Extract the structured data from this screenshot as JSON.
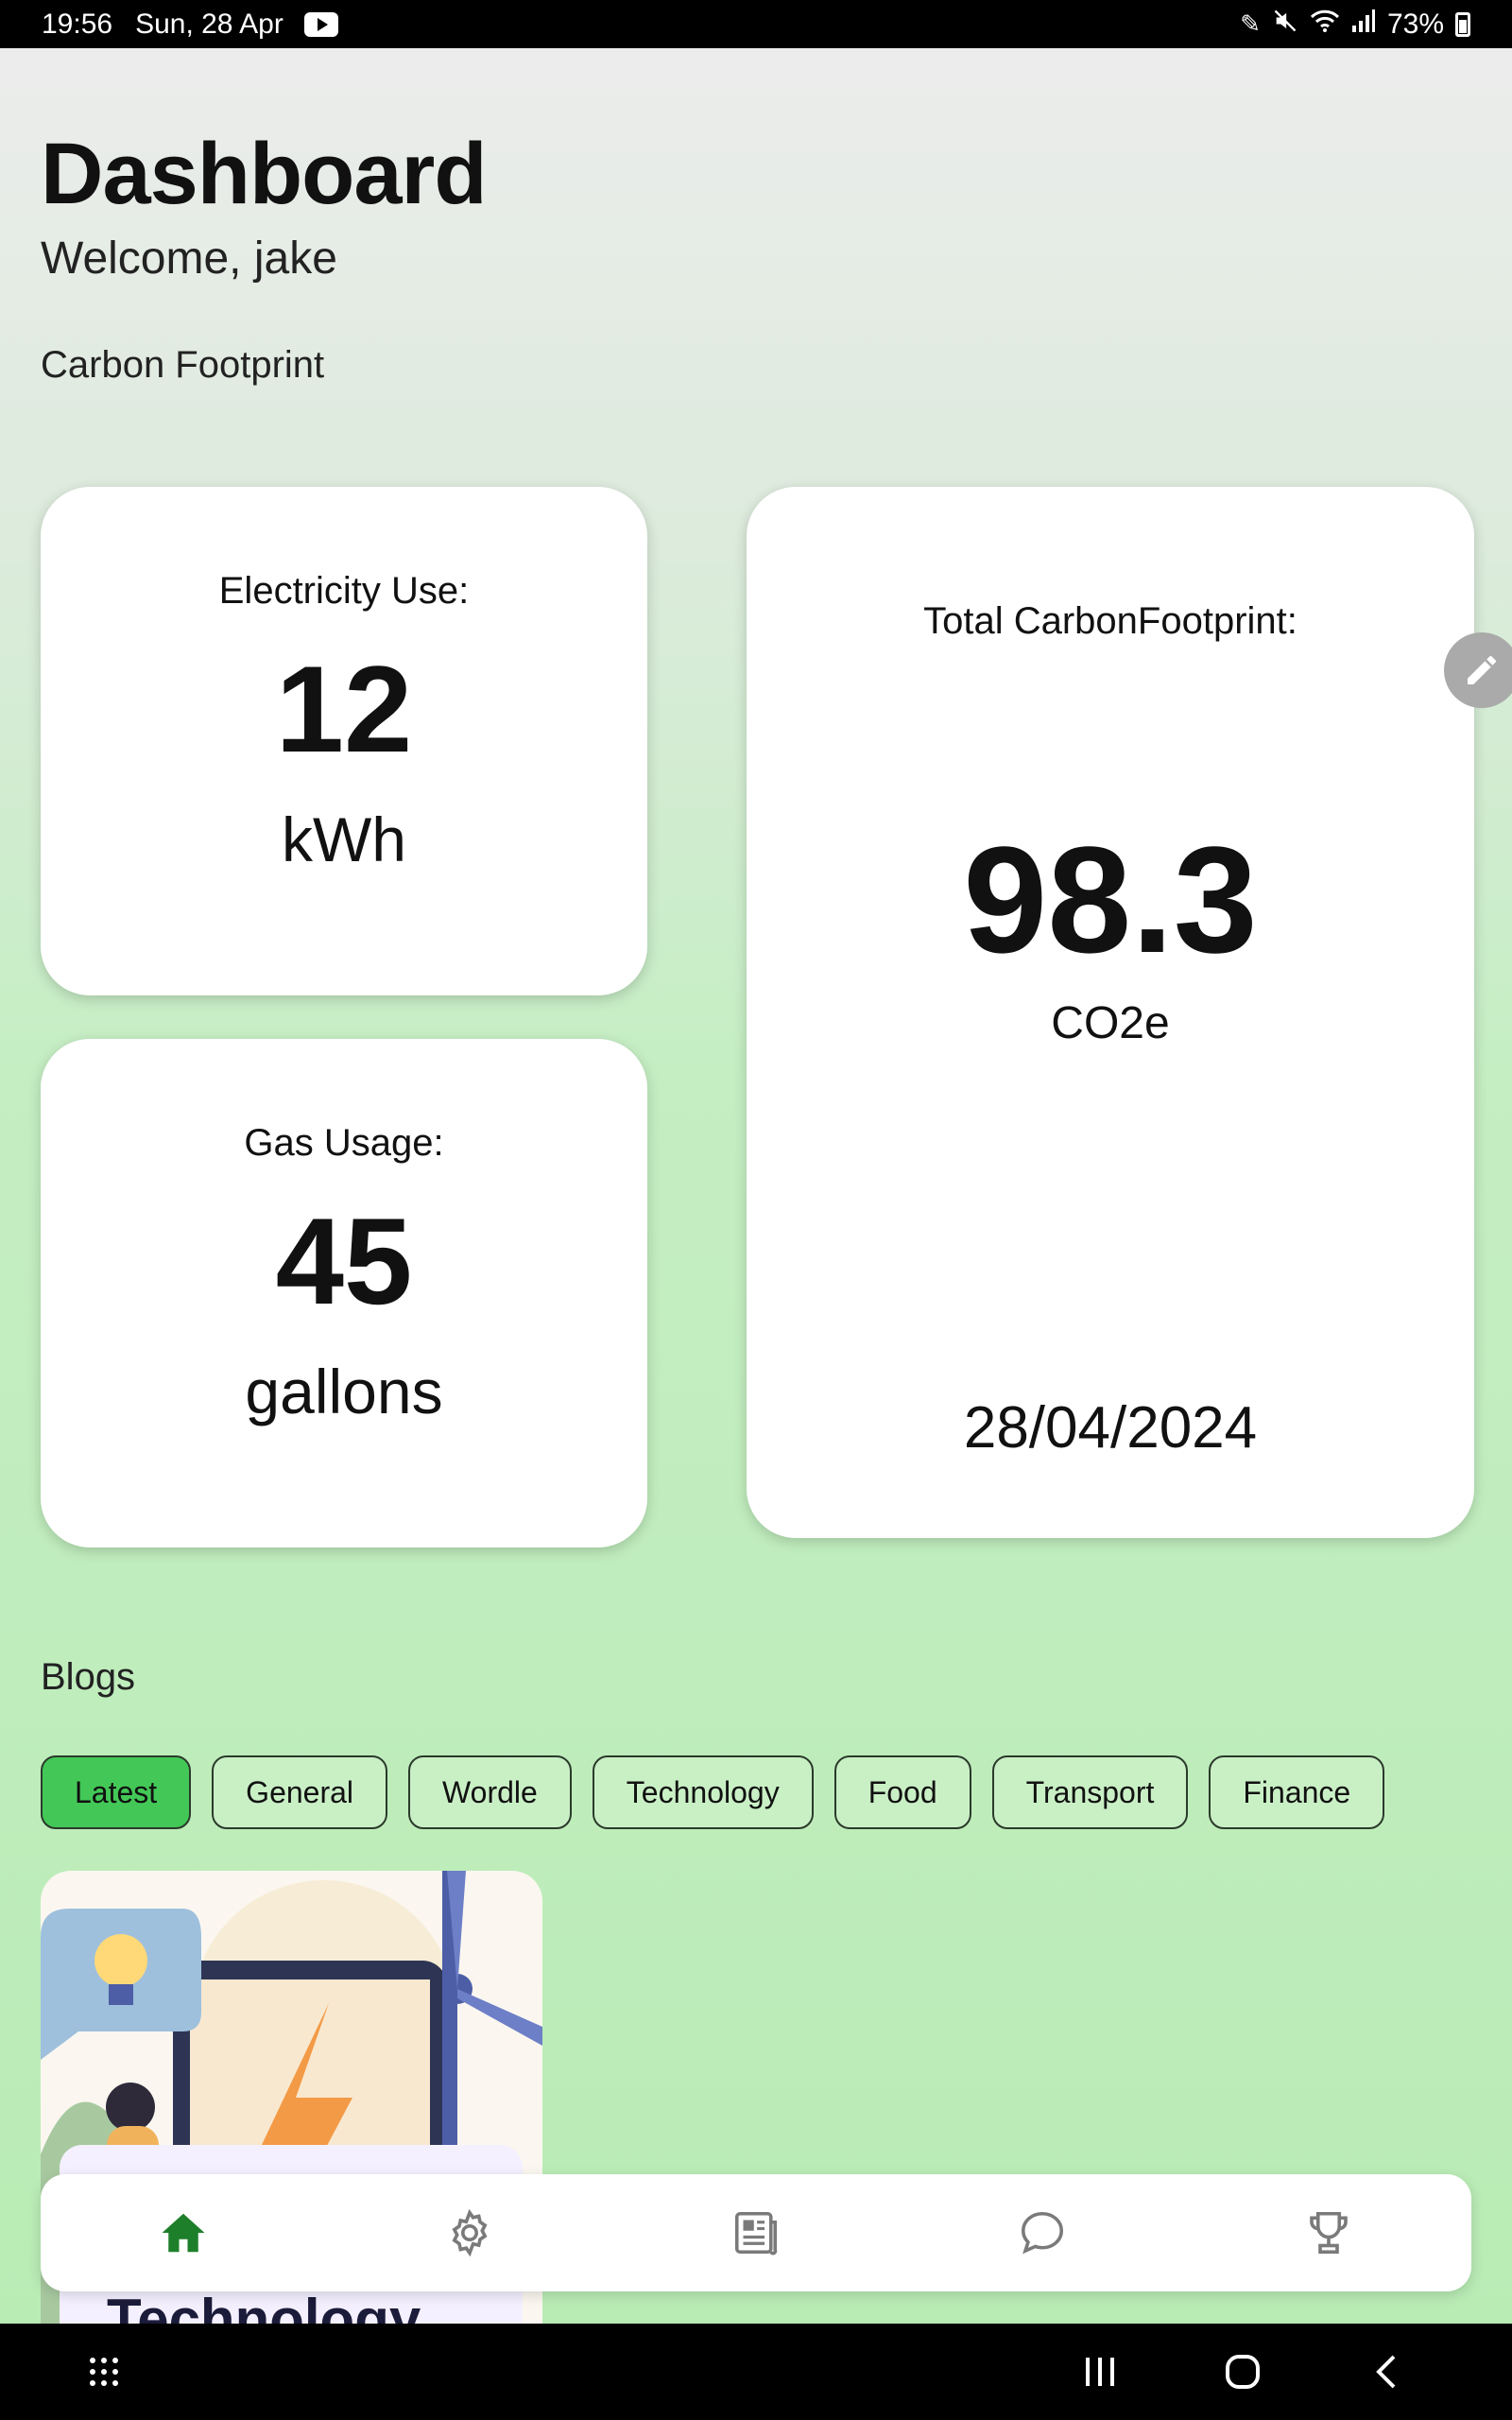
{
  "status_bar": {
    "time": "19:56",
    "date": "Sun, 28 Apr",
    "battery": "73%",
    "icons": [
      "youtube-icon",
      "pen-icon",
      "mute-icon",
      "wifi-icon",
      "signal-icon",
      "battery-icon"
    ]
  },
  "header": {
    "title": "Dashboard",
    "welcome": "Welcome, jake"
  },
  "carbon": {
    "section_label": "Carbon Footprint",
    "electricity": {
      "label": "Electricity Use:",
      "value": "12",
      "unit": "kWh"
    },
    "gas": {
      "label": "Gas Usage:",
      "value": "45",
      "unit": "gallons"
    },
    "total": {
      "label": "Total CarbonFootprint:",
      "value": "98.3",
      "unit": "CO2e",
      "date": "28/04/2024"
    }
  },
  "blogs": {
    "section_label": "Blogs",
    "chips": [
      {
        "label": "Latest",
        "active": true
      },
      {
        "label": "General",
        "active": false
      },
      {
        "label": "Wordle",
        "active": false
      },
      {
        "label": "Technology",
        "active": false
      },
      {
        "label": "Food",
        "active": false
      },
      {
        "label": "Transport",
        "active": false
      },
      {
        "label": "Finance",
        "active": false
      }
    ],
    "card": {
      "title": "Technology"
    }
  },
  "bottom_nav": {
    "items": [
      "home-icon",
      "settings-icon",
      "news-icon",
      "chat-icon",
      "trophy-icon"
    ],
    "active": "home-icon"
  },
  "colors": {
    "accent": "#43c857",
    "nav_active": "#1e7f2a",
    "nav_inactive": "#7a7a7a"
  }
}
